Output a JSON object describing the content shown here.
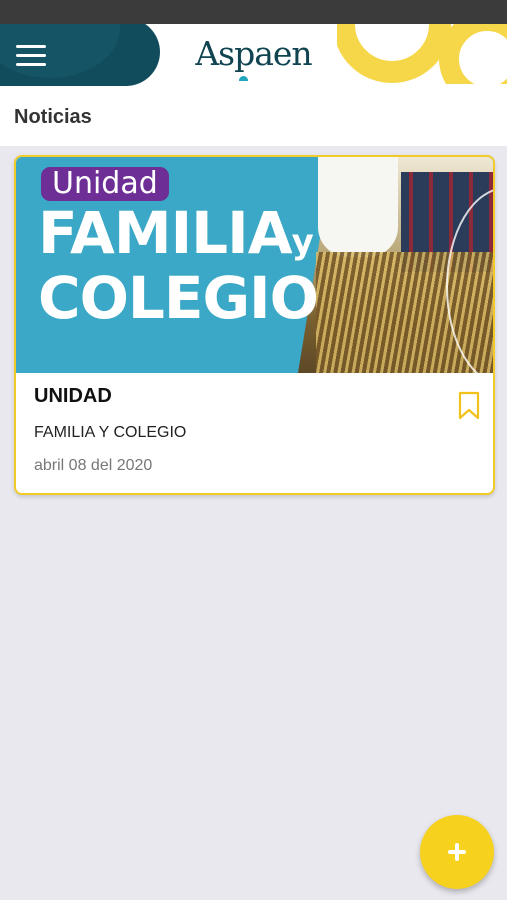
{
  "header": {
    "brand": "Aspaen",
    "menu_icon": "hamburger-menu-icon"
  },
  "page": {
    "title": "Noticias"
  },
  "news": [
    {
      "image_tag": "Unidad",
      "image_heading_line1": "FAMILIA",
      "image_heading_y": "y",
      "image_heading_line2": "COLEGIO",
      "title": "UNIDAD",
      "subtitle": "FAMILIA Y COLEGIO",
      "date": "abril 08 del 2020",
      "bookmark_icon": "bookmark-outline-icon"
    }
  ],
  "fab": {
    "icon": "plus-icon"
  },
  "colors": {
    "header_teal": "#114c5c",
    "accent_yellow": "#f6d21f",
    "card_border": "#f2cb2b",
    "background": "#e9e8ee",
    "image_blue": "#3aa8c6",
    "tag_purple": "#6d2f96"
  }
}
